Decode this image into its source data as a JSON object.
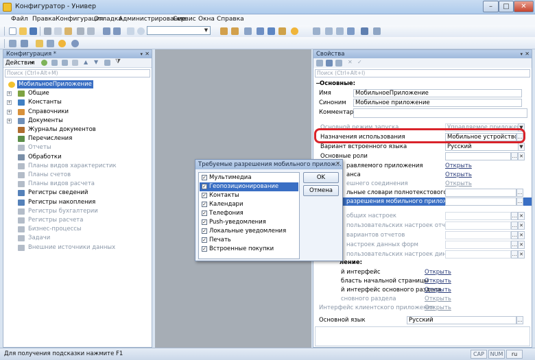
{
  "window": {
    "title": "Конфигуратор - Универ"
  },
  "menu": [
    "Файл",
    "Правка",
    "Конфигурация",
    "Отладка",
    "Администрирование",
    "Сервис",
    "Окна",
    "Справка"
  ],
  "left_panel": {
    "title": "Конфигурация *",
    "actions_label": "Действия",
    "search_placeholder": "Поиск (Ctrl+Alt+M)",
    "root": "МобильноеПриложение",
    "items": [
      {
        "label": "Общие",
        "expandable": true,
        "disabled": false,
        "color": "#7ea342"
      },
      {
        "label": "Константы",
        "expandable": true,
        "disabled": false,
        "color": "#3f7fc3"
      },
      {
        "label": "Справочники",
        "expandable": true,
        "disabled": false,
        "color": "#d8913a"
      },
      {
        "label": "Документы",
        "expandable": true,
        "disabled": false,
        "color": "#6f8fb8"
      },
      {
        "label": "Журналы документов",
        "expandable": false,
        "disabled": false,
        "color": "#b06d2f"
      },
      {
        "label": "Перечисления",
        "expandable": false,
        "disabled": false,
        "color": "#5d8f4a"
      },
      {
        "label": "Отчеты",
        "expandable": false,
        "disabled": true,
        "color": "#b3bcc8"
      },
      {
        "label": "Обработки",
        "expandable": false,
        "disabled": false,
        "color": "#7a8fa8"
      },
      {
        "label": "Планы видов характеристик",
        "expandable": false,
        "disabled": true,
        "color": "#b3bcc8"
      },
      {
        "label": "Планы счетов",
        "expandable": false,
        "disabled": true,
        "color": "#b3bcc8"
      },
      {
        "label": "Планы видов расчета",
        "expandable": false,
        "disabled": true,
        "color": "#b3bcc8"
      },
      {
        "label": "Регистры сведений",
        "expandable": false,
        "disabled": false,
        "color": "#5581b9"
      },
      {
        "label": "Регистры накопления",
        "expandable": false,
        "disabled": false,
        "color": "#5581b9"
      },
      {
        "label": "Регистры бухгалтерии",
        "expandable": false,
        "disabled": true,
        "color": "#b3bcc8"
      },
      {
        "label": "Регистры расчета",
        "expandable": false,
        "disabled": true,
        "color": "#b3bcc8"
      },
      {
        "label": "Бизнес-процессы",
        "expandable": false,
        "disabled": true,
        "color": "#b3bcc8"
      },
      {
        "label": "Задачи",
        "expandable": false,
        "disabled": true,
        "color": "#b3bcc8"
      },
      {
        "label": "Внешние источники данных",
        "expandable": false,
        "disabled": true,
        "color": "#b3bcc8"
      }
    ]
  },
  "props": {
    "title": "Свойства",
    "search_placeholder": "Поиск (Ctrl+Alt+I)",
    "section_main": "Основные:",
    "name_label": "Имя",
    "name_value": "МобильноеПриложение",
    "synonym_label": "Синоним",
    "synonym_value": "Мобильное приложение",
    "comment_label": "Комментарий",
    "launch_mode_label": "Основной режим запуска",
    "launch_mode_value": "Управляемое приложение",
    "purpose_label": "Назначения использования",
    "purpose_value": "Мобильное устройство",
    "builtin_lang_label": "Вариант встроенного языка",
    "builtin_lang_value": "Русский",
    "roles_label": "Основные роли",
    "managed_app_label": "равляемого приложения",
    "session_label": "анса",
    "external_conn_label": "ешнего соединения",
    "fulltext_label": "льные словари полнотекстового поиска",
    "mobile_perm_label": "разрешения мобильного приложения",
    "link_open": "Открыть",
    "general_settings_label": "общих настроек",
    "user_report_label": "пользовательских настроек отчетов",
    "report_variants_label": "вариантов отчетов",
    "form_data_label": "настроек данных форм",
    "dynamic_label": "пользовательских настроек динамическ",
    "section_interface": "ление:",
    "iface_label": "й интерфейс",
    "home_label": "бласть начальной страницы",
    "main_section_iface_label": "й интерфейс основного раздела",
    "main_section_label": "сновного раздела",
    "client_iface_label": "Интерфейс клиентского приложения",
    "main_lang_label": "Основной язык",
    "main_lang_value": "Русский"
  },
  "dialog": {
    "title": "Требуемые разрешения мобильного прилож...",
    "ok_label": "OK",
    "cancel_label": "Отмена",
    "items": [
      {
        "label": "Мультимедиа",
        "checked": true
      },
      {
        "label": "Геопозиционирование",
        "checked": true,
        "selected": true
      },
      {
        "label": "Контакты",
        "checked": true
      },
      {
        "label": "Календари",
        "checked": true
      },
      {
        "label": "Телефония",
        "checked": true
      },
      {
        "label": "Push-уведомления",
        "checked": true
      },
      {
        "label": "Локальные уведомления",
        "checked": true
      },
      {
        "label": "Печать",
        "checked": true
      },
      {
        "label": "Встроенные покупки",
        "checked": true
      }
    ]
  },
  "status": {
    "hint": "Для получения подсказки нажмите F1",
    "cap": "CAP",
    "num": "NUM",
    "lang": "ru"
  }
}
